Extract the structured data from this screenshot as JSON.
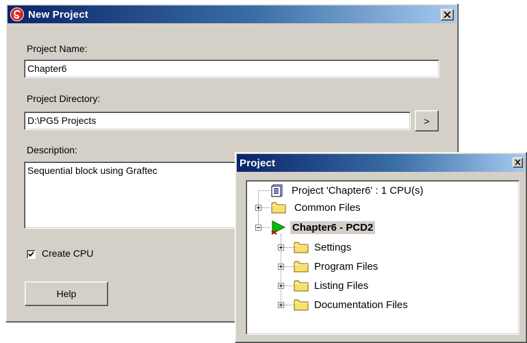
{
  "new_project_dialog": {
    "title": "New Project",
    "project_name_label": "Project Name:",
    "project_name_value": "Chapter6",
    "project_directory_label": "Project Directory:",
    "project_directory_value": "D:\\PG5 Projects",
    "browse_label": ">",
    "description_label": "Description:",
    "description_value": "Sequential block using Graftec",
    "create_cpu_label": "Create CPU",
    "create_cpu_checked": true,
    "help_label": "Help",
    "close_symbol": "×"
  },
  "project_window": {
    "title": "Project",
    "tree": [
      {
        "label": "Project 'Chapter6' : 1 CPU(s)",
        "icon": "project-icon"
      },
      {
        "label": "Common Files",
        "icon": "folder-icon"
      },
      {
        "label": "Chapter6 - PCD2",
        "icon": "cpu-icon",
        "selected": true
      },
      {
        "label": "Settings",
        "icon": "folder-icon"
      },
      {
        "label": "Program Files",
        "icon": "folder-icon"
      },
      {
        "label": "Listing Files",
        "icon": "folder-icon"
      },
      {
        "label": "Documentation Files",
        "icon": "folder-icon"
      }
    ]
  },
  "colors": {
    "titlebar_start": "#0a246a",
    "titlebar_end": "#a6caf0",
    "dialog_face": "#d4d0c8",
    "folder_yellow": "#f8e070",
    "cpu_green": "#00c000",
    "selection_gray": "#d4d0c8"
  }
}
